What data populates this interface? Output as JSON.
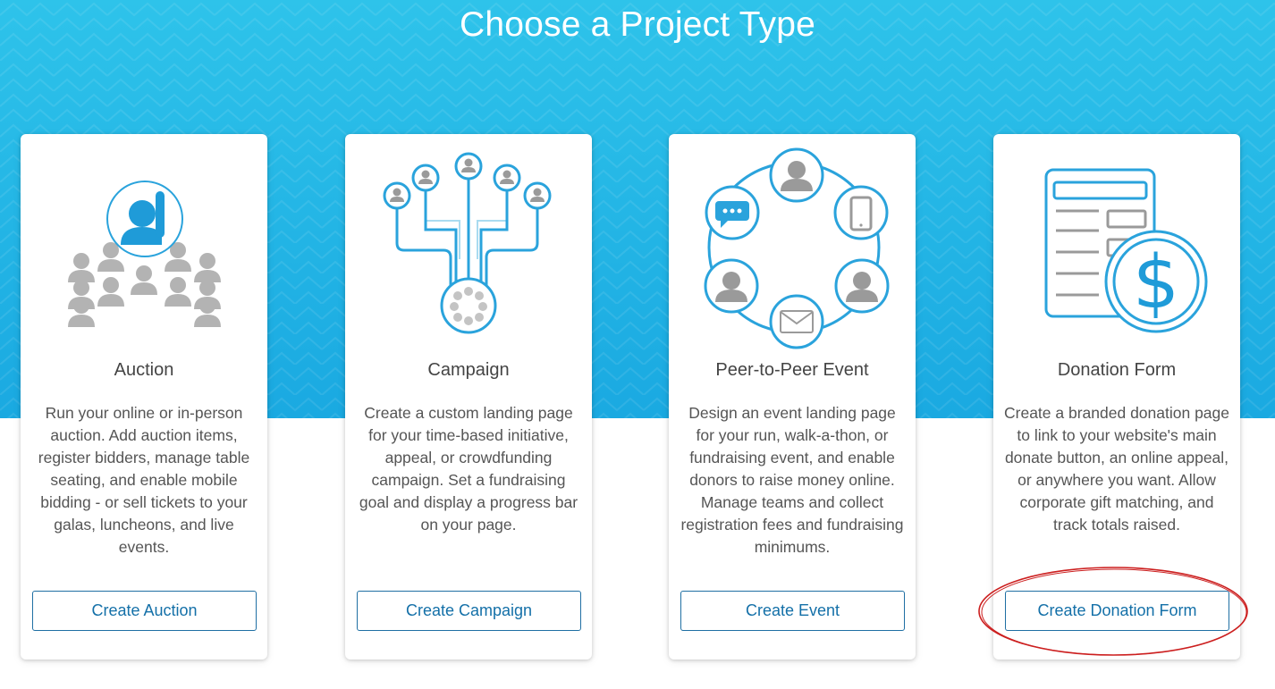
{
  "header": {
    "title": "Choose a Project Type"
  },
  "theme": {
    "hero_color": "#29bbe8",
    "icon_blue": "#2aa3dc",
    "icon_gray": "#b3b3b3",
    "button_text": "#1470a8",
    "annotation_red": "#cc1f1f"
  },
  "cards": [
    {
      "title": "Auction",
      "description": "Run your online or in-person auction. Add auction items, register bidders, manage table seating, and enable mobile bidding - or sell tickets to your galas, luncheons, and live events.",
      "button": "Create Auction",
      "icon": "auction-crowd-icon"
    },
    {
      "title": "Campaign",
      "description": "Create a custom landing page for your time-based initiative, appeal, or crowdfunding campaign. Set a fundraising goal and display a progress bar on your page.",
      "button": "Create Campaign",
      "icon": "campaign-network-icon"
    },
    {
      "title": "Peer-to-Peer Event",
      "description": "Design an event landing page for your run, walk-a-thon, or fundraising event, and enable donors to raise money online. Manage teams and collect registration fees and fundraising minimums.",
      "button": "Create Event",
      "icon": "peer-to-peer-circle-icon"
    },
    {
      "title": "Donation Form",
      "description": "Create a branded donation page to link to your website's main donate button, an online appeal, or anywhere you want. Allow corporate gift matching, and track totals raised.",
      "button": "Create Donation Form",
      "icon": "donation-form-dollar-icon"
    }
  ]
}
